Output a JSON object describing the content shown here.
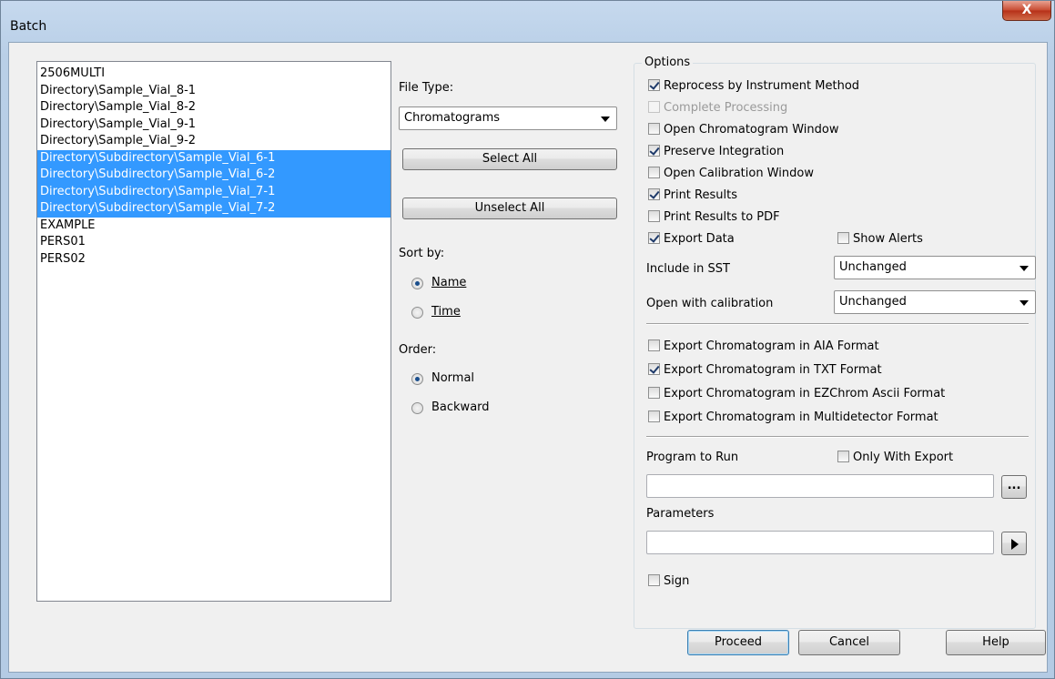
{
  "window": {
    "title": "Batch",
    "close_label": "X"
  },
  "file_list": {
    "items": [
      {
        "label": "2506MULTI",
        "selected": false
      },
      {
        "label": "Directory\\Sample_Vial_8-1",
        "selected": false
      },
      {
        "label": "Directory\\Sample_Vial_8-2",
        "selected": false
      },
      {
        "label": "Directory\\Sample_Vial_9-1",
        "selected": false
      },
      {
        "label": "Directory\\Sample_Vial_9-2",
        "selected": false
      },
      {
        "label": "Directory\\Subdirectory\\Sample_Vial_6-1",
        "selected": true
      },
      {
        "label": "Directory\\Subdirectory\\Sample_Vial_6-2",
        "selected": true
      },
      {
        "label": "Directory\\Subdirectory\\Sample_Vial_7-1",
        "selected": true
      },
      {
        "label": "Directory\\Subdirectory\\Sample_Vial_7-2",
        "selected": true
      },
      {
        "label": "EXAMPLE",
        "selected": false
      },
      {
        "label": "PERS01",
        "selected": false
      },
      {
        "label": "PERS02",
        "selected": false
      }
    ]
  },
  "middle": {
    "file_type_label": "File Type:",
    "file_type_value": "Chromatograms",
    "select_all": "Select All",
    "unselect_all": "Unselect All",
    "sort_by_label": "Sort by:",
    "sort_name": "Name",
    "sort_time": "Time",
    "order_label": "Order:",
    "order_normal": "Normal",
    "order_backward": "Backward"
  },
  "options": {
    "title": "Options",
    "reprocess": "Reprocess by Instrument Method",
    "complete_processing": "Complete Processing",
    "open_chrom_window": "Open Chromatogram Window",
    "preserve_integration": "Preserve Integration",
    "open_calib_window": "Open Calibration Window",
    "print_results": "Print Results",
    "print_results_pdf": "Print Results to PDF",
    "export_data": "Export Data",
    "show_alerts": "Show Alerts",
    "include_sst_label": "Include in SST",
    "include_sst_value": "Unchanged",
    "open_with_calib_label": "Open with calibration",
    "open_with_calib_value": "Unchanged",
    "export_aia": "Export Chromatogram in AIA Format",
    "export_txt": "Export Chromatogram in TXT Format",
    "export_ezchrom": "Export Chromatogram in EZChrom Ascii Format",
    "export_multidetector": "Export Chromatogram in Multidetector Format",
    "program_to_run_label": "Program to Run",
    "only_with_export": "Only With Export",
    "program_value": "",
    "browse_label": "...",
    "parameters_label": "Parameters",
    "parameters_value": "",
    "sign": "Sign"
  },
  "footer": {
    "proceed": "Proceed",
    "cancel": "Cancel",
    "help": "Help"
  }
}
